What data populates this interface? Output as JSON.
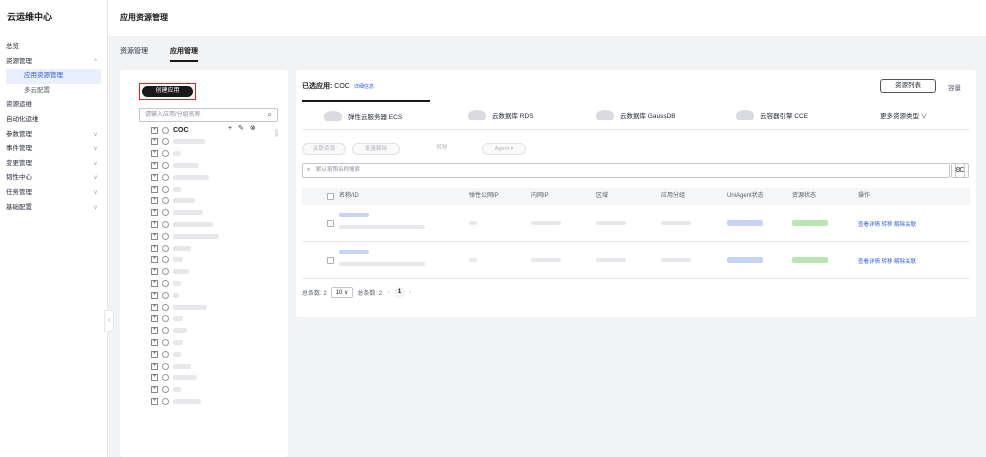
{
  "nav": {
    "title": "云运维中心",
    "items": [
      {
        "label": "总览"
      },
      {
        "label": "资源管理",
        "chevron": "^"
      },
      {
        "label": "应用资源管理"
      },
      {
        "label": "多云配置"
      },
      {
        "label": "资源运维"
      },
      {
        "label": "自动化运维"
      },
      {
        "label": "参数管理",
        "chevron": "v"
      },
      {
        "label": "事件管理",
        "chevron": "v"
      },
      {
        "label": "变更管理",
        "chevron": "v"
      },
      {
        "label": "韧性中心",
        "chevron": "v"
      },
      {
        "label": "任务管理",
        "chevron": "v"
      },
      {
        "label": "基础配置",
        "chevron": "v"
      }
    ],
    "collapse_glyph": "‹"
  },
  "header": {
    "page_title": "应用资源管理"
  },
  "tabs": [
    {
      "label": "资源管理"
    },
    {
      "label": "应用管理"
    }
  ],
  "tree": {
    "create_label": "创建应用",
    "search_placeholder": "请输入应用/分组名称",
    "root_label": "COC",
    "root_actions": "+ ✎ ⊗",
    "expand_glyph": "+"
  },
  "main": {
    "selected_prefix": "已选应用:",
    "selected_app": "COC",
    "detail_link": "详细信息",
    "resource_list_button": "资源列表",
    "capacity_label": "容量",
    "resource_tabs": [
      {
        "label": "弹性云服务器 ECS"
      },
      {
        "label": "云数据库 RDS"
      },
      {
        "label": "云数据库 GaussDB"
      },
      {
        "label": "云容器引擎 CCE"
      }
    ],
    "more_types": "更多资源类型 ∨",
    "action_buttons": [
      "关联资源",
      "批量解除",
      "转移",
      "Agent ▾"
    ],
    "search_placeholder": "默认按照名称搜索",
    "columns": [
      "名称/ID",
      "弹性公网IP",
      "内网IP",
      "区域",
      "应用分组",
      "UniAgent状态",
      "资源状态",
      "操作"
    ],
    "row_ops": [
      "查看详情",
      "转移",
      "解除关联"
    ],
    "rows": 2,
    "pager": {
      "total_label": "总条数: 2",
      "page_size": "10",
      "total_label2": "总条数: 2",
      "prev": "‹",
      "page": "1",
      "next": "›"
    }
  }
}
